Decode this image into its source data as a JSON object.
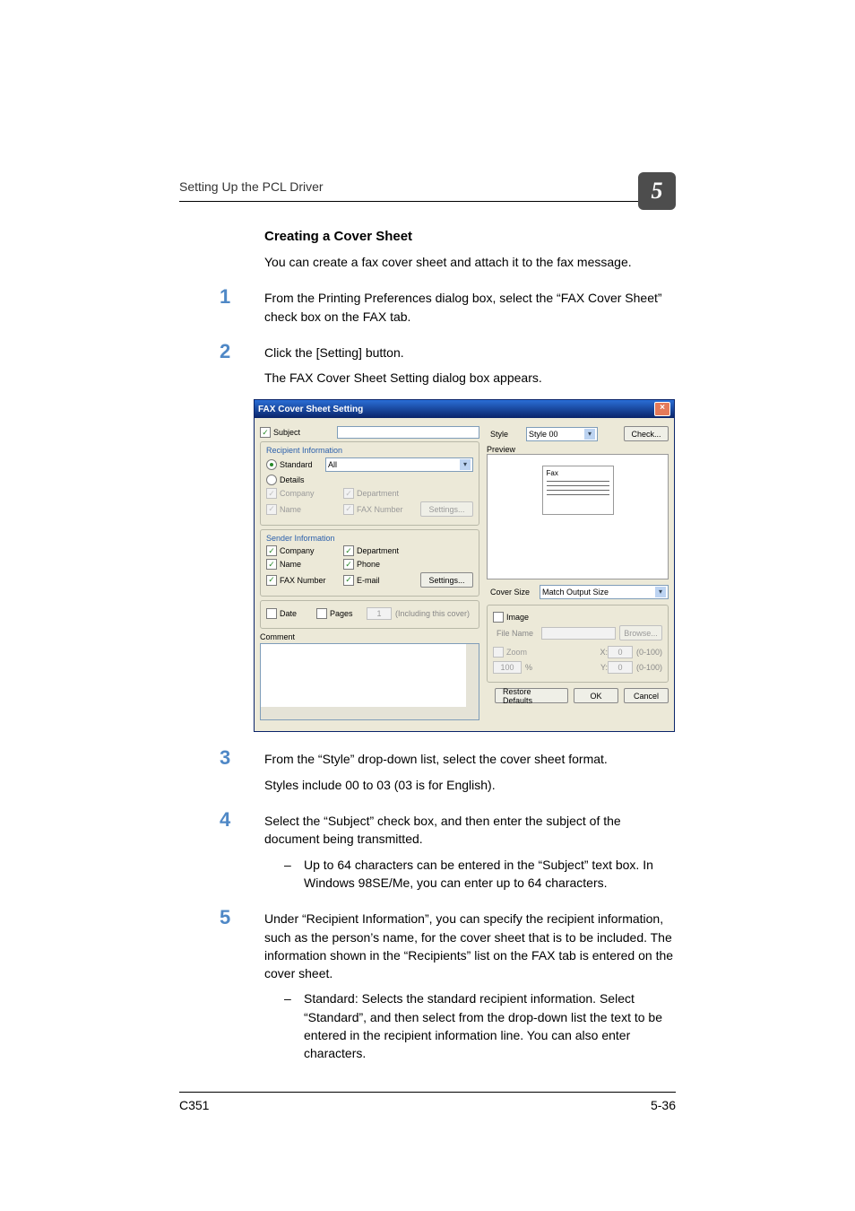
{
  "page": {
    "running_head": "Setting Up the PCL Driver",
    "chapter_number": "5",
    "model": "C351",
    "page_number": "5-36"
  },
  "section": {
    "h3": "Creating a Cover Sheet",
    "intro": "You can create a fax cover sheet and attach it to the fax message."
  },
  "steps": {
    "s1": {
      "num": "1",
      "text": "From the Printing Preferences dialog box, select the “FAX Cover Sheet” check box on the FAX tab."
    },
    "s2": {
      "num": "2",
      "text": "Click the [Setting] button.",
      "sub": "The FAX Cover Sheet Setting dialog box appears."
    },
    "s3": {
      "num": "3",
      "text": "From the “Style” drop-down list, select the cover sheet format.",
      "sub": "Styles include 00 to 03 (03 is for English)."
    },
    "s4": {
      "num": "4",
      "text": "Select the “Subject” check box, and then enter the subject of the document being transmitted.",
      "bullet": "Up to 64 characters can be entered in the “Subject” text box. In Windows 98SE/Me, you can enter up to 64 characters."
    },
    "s5": {
      "num": "5",
      "text": "Under “Recipient Information”, you can specify the recipient information, such as the person’s name, for the cover sheet that is to be included. The information shown in the “Recipients” list on the FAX tab is entered on the cover sheet.",
      "bullet": "Standard: Selects the standard recipient information. Select “Standard”, and then select from the drop-down list the text to be entered in the recipient information line. You can also enter characters."
    }
  },
  "dialog": {
    "title": "FAX Cover Sheet Setting",
    "close": "×",
    "subject_label": "Subject",
    "recipient_info": "Recipient Information",
    "standard": "Standard",
    "standard_value": "All",
    "details": "Details",
    "company": "Company",
    "department": "Department",
    "name": "Name",
    "fax_number_lbl": "FAX Number",
    "settings_btn": "Settings...",
    "sender_info": "Sender Information",
    "phone": "Phone",
    "fax_number": "FAX Number",
    "email": "E-mail",
    "date": "Date",
    "pages": "Pages",
    "pages_val": "1",
    "pages_note": "(Including this cover)",
    "comment": "Comment",
    "style": "Style",
    "style_value": "Style 00",
    "check_btn": "Check...",
    "preview": "Preview",
    "fax_preview": "Fax",
    "cover_size": "Cover Size",
    "cover_size_value": "Match Output Size",
    "image": "Image",
    "file_name": "File Name",
    "browse_btn": "Browse...",
    "zoom": "Zoom",
    "zoom_val": "100",
    "zoom_pct": "%",
    "x": "X:",
    "y": "Y:",
    "zero": "0",
    "range": "(0-100)",
    "restore": "Restore Defaults",
    "ok": "OK",
    "cancel": "Cancel"
  }
}
